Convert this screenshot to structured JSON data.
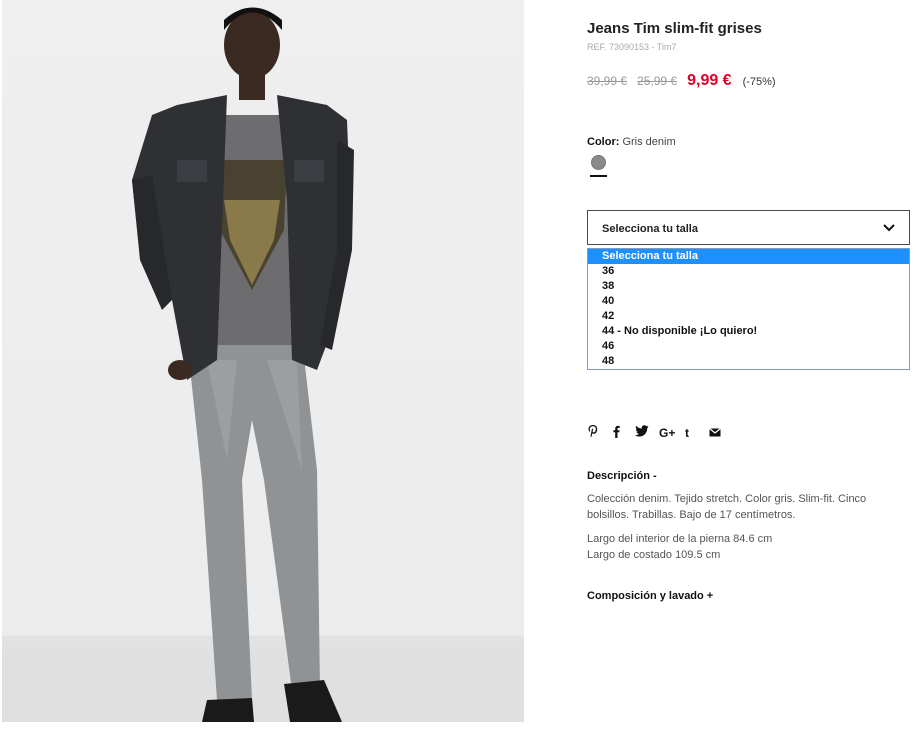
{
  "product": {
    "title": "Jeans Tim slim-fit grises",
    "ref": "REF. 73090153 - Tim7",
    "price_original": "39,99 €",
    "price_previous": "25,99 €",
    "price_current": "9,99 €",
    "discount": "(-75%)"
  },
  "color": {
    "label": "Color:",
    "value": "Gris denim",
    "swatch": "#8a8a8a"
  },
  "size_select": {
    "label": "Selecciona tu talla",
    "options": [
      "Selecciona tu talla",
      "36",
      "38",
      "40",
      "42",
      "44 - No disponible ¡Lo quiero!",
      "46",
      "48"
    ]
  },
  "share": {
    "icons": [
      "pinterest-icon",
      "facebook-icon",
      "twitter-icon",
      "google-plus-icon",
      "tumblr-icon",
      "email-icon"
    ],
    "glyphs": [
      "℗",
      "f",
      "🐦",
      "G+",
      "t",
      "✉"
    ]
  },
  "description": {
    "heading": "Descripción -",
    "text": "Colección denim. Tejido stretch. Color gris. Slim-fit. Cinco bolsillos. Trabillas. Bajo de 17 centímetros.",
    "inseam": "Largo del interior de la pierna 84.6 cm",
    "outseam": "Largo de costado 109.5 cm"
  },
  "composition": {
    "heading": "Composición y lavado +"
  },
  "colors": {
    "price_red": "#e0002a",
    "selected_option": "#1e90ff",
    "dropdown_border": "#7a9cc7"
  }
}
